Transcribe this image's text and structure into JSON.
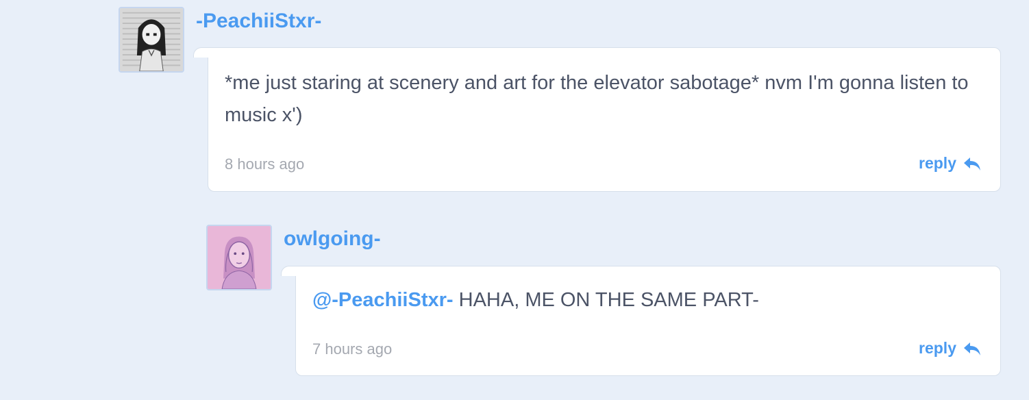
{
  "comments": [
    {
      "username": "-PeachiiStxr-",
      "text": "*me just staring at scenery and art for the elevator sabotage* nvm I'm gonna listen to music x')",
      "time": "8 hours ago",
      "reply_label": "reply",
      "avatar_icon": "user-avatar-icon"
    },
    {
      "username": "owlgoing-",
      "mention": "@-PeachiiStxr-",
      "text": " HAHA, ME ON THE SAME PART-",
      "time": "7 hours ago",
      "reply_label": "reply",
      "avatar_icon": "user-avatar-icon"
    }
  ],
  "colors": {
    "background": "#e8eff9",
    "accent": "#4a9af0",
    "text": "#4b5366",
    "muted": "#a4a8b0"
  }
}
